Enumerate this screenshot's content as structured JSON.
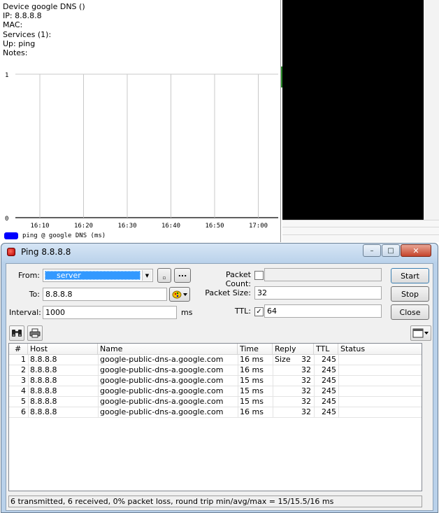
{
  "device": {
    "name_line": "Device google DNS ()",
    "ip_line": "IP: 8.8.8.8",
    "mac_line": "MAC:",
    "services_line": "Services (1):",
    "up_line": "Up: ping",
    "notes_line": "Notes:"
  },
  "chart_data": {
    "type": "line",
    "x_ticks": [
      "16:10",
      "16:20",
      "16:30",
      "16:40",
      "16:50",
      "17:00"
    ],
    "y_ticks": [
      "0",
      "1"
    ],
    "ylim": [
      0,
      1
    ],
    "series": [
      {
        "name": "ping @ google DNS (ms)",
        "values": []
      }
    ],
    "grid": true,
    "legend_position": "bottom-left",
    "legend_color": "#0000ff"
  },
  "ping_window": {
    "title": "Ping 8.8.8.8",
    "window_buttons": {
      "minimize": "–",
      "maximize": "□",
      "close": "✕"
    },
    "from_label": "From:",
    "from_value": "server",
    "to_label": "To:",
    "to_value": "8.8.8.8",
    "interval_label": "Interval:",
    "interval_value": "1000",
    "interval_unit": "ms",
    "packet_count_label": "Packet Count:",
    "packet_count_checked": false,
    "packet_count_value": "",
    "packet_size_label": "Packet Size:",
    "packet_size_value": "32",
    "ttl_label": "TTL:",
    "ttl_checked": true,
    "ttl_value": "64",
    "small_button_1": "",
    "small_button_2": "...",
    "start_label": "Start",
    "stop_label": "Stop",
    "close_label": "Close",
    "columns": [
      "#",
      "Host",
      "Name",
      "Time",
      "Reply Size",
      "TTL",
      "Status"
    ],
    "rows": [
      {
        "num": "1",
        "host": "8.8.8.8",
        "name": "google-public-dns-a.google.com",
        "time": "16 ms",
        "reply_size": "32",
        "ttl": "245",
        "status": ""
      },
      {
        "num": "2",
        "host": "8.8.8.8",
        "name": "google-public-dns-a.google.com",
        "time": "16 ms",
        "reply_size": "32",
        "ttl": "245",
        "status": ""
      },
      {
        "num": "3",
        "host": "8.8.8.8",
        "name": "google-public-dns-a.google.com",
        "time": "15 ms",
        "reply_size": "32",
        "ttl": "245",
        "status": ""
      },
      {
        "num": "4",
        "host": "8.8.8.8",
        "name": "google-public-dns-a.google.com",
        "time": "15 ms",
        "reply_size": "32",
        "ttl": "245",
        "status": ""
      },
      {
        "num": "5",
        "host": "8.8.8.8",
        "name": "google-public-dns-a.google.com",
        "time": "15 ms",
        "reply_size": "32",
        "ttl": "245",
        "status": ""
      },
      {
        "num": "6",
        "host": "8.8.8.8",
        "name": "google-public-dns-a.google.com",
        "time": "16 ms",
        "reply_size": "32",
        "ttl": "245",
        "status": ""
      }
    ],
    "status_text": "6 transmitted, 6 received, 0% packet loss, round trip min/avg/max = 15/15.5/16 ms",
    "icons": {
      "find": "binoculars-icon",
      "print": "printer-icon",
      "columns": "columns-icon",
      "colors": "color-palette-icon",
      "title": "ping-app-icon"
    }
  }
}
